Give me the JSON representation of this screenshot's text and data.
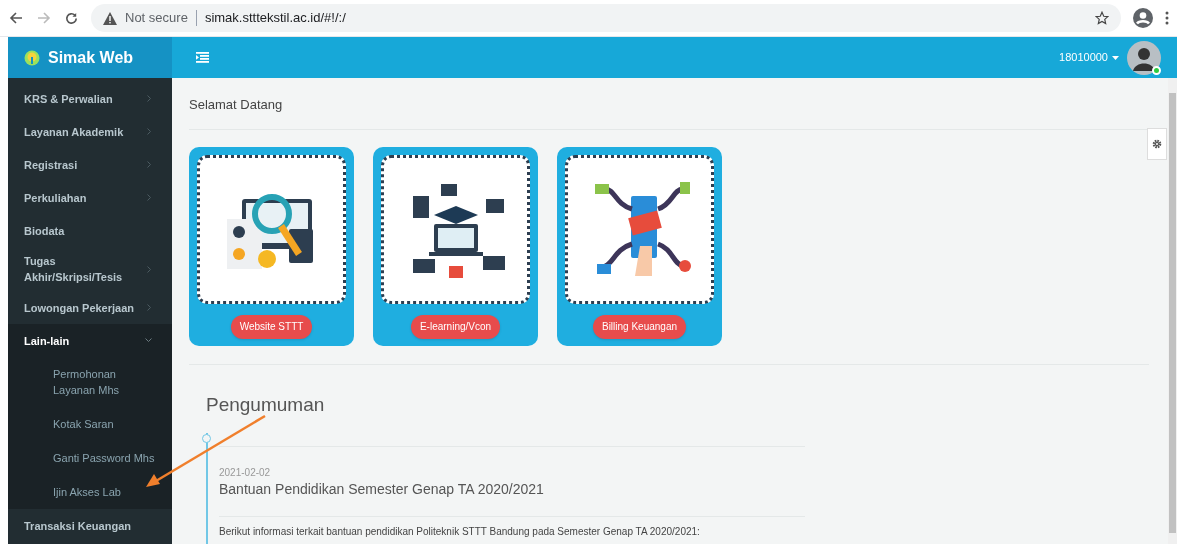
{
  "browser": {
    "security_label": "Not secure",
    "url": "simak.stttekstil.ac.id/#!/:/"
  },
  "app": {
    "title": "Simak Web",
    "user_id": "18010000",
    "user_online": true
  },
  "sidebar": {
    "items": [
      {
        "label": "KRS & Perwalian",
        "has_submenu": true,
        "expanded": false
      },
      {
        "label": "Layanan Akademik",
        "has_submenu": true,
        "expanded": false
      },
      {
        "label": "Registrasi",
        "has_submenu": true,
        "expanded": false
      },
      {
        "label": "Perkuliahan",
        "has_submenu": true,
        "expanded": false
      },
      {
        "label": "Biodata",
        "has_submenu": false,
        "expanded": false
      },
      {
        "label": "Tugas Akhir/Skripsi/Tesis",
        "has_submenu": true,
        "expanded": false
      },
      {
        "label": "Lowongan Pekerjaan",
        "has_submenu": true,
        "expanded": false
      },
      {
        "label": "Lain-lain",
        "has_submenu": true,
        "expanded": true,
        "children": [
          {
            "label": "Permohonan Layanan Mhs"
          },
          {
            "label": "Kotak Saran"
          },
          {
            "label": "Ganti Password Mhs"
          },
          {
            "label": "Ijin Akses Lab"
          }
        ]
      },
      {
        "label": "Transaksi Keuangan",
        "has_submenu": false,
        "expanded": false
      }
    ]
  },
  "breadcrumb": "Selamat Datang",
  "cards": [
    {
      "kind": "website",
      "button": "Website STTT"
    },
    {
      "kind": "elearning",
      "button": "E-learning/Vcon"
    },
    {
      "kind": "billing",
      "button": "Billing Keuangan"
    }
  ],
  "announcements": {
    "title": "Pengumuman",
    "items": [
      {
        "date": "2021-02-02",
        "title": "Bantuan Pendidikan Semester Genap TA 2020/2021",
        "body": "Berikut informasi terkait bantuan pendidikan Politeknik STTT Bandung pada Semester Genap TA 2020/2021:"
      }
    ]
  }
}
